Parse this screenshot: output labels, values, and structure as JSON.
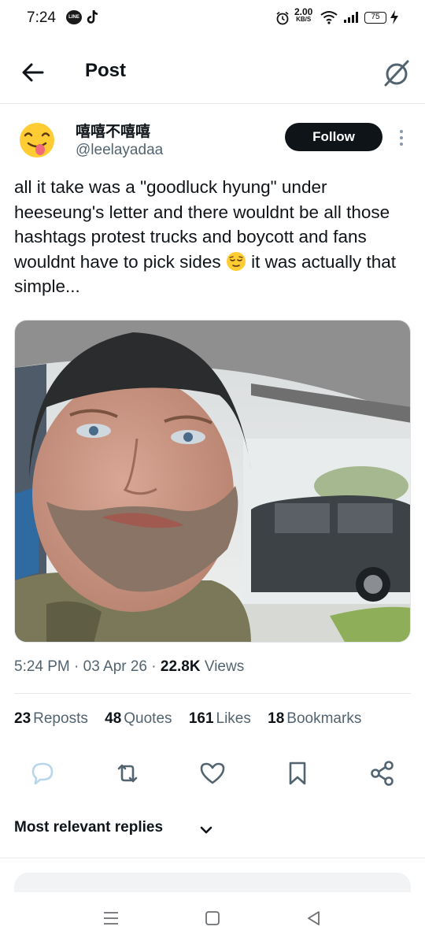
{
  "status_bar": {
    "time": "7:24",
    "app_icon_1": "LINE",
    "net_speed_value": "2.00",
    "net_speed_unit": "KB/S",
    "battery": "75"
  },
  "header": {
    "title": "Post",
    "back_icon": "arrow-left-icon",
    "grok_icon": "grok-icon"
  },
  "author": {
    "display_name": "嘻嘻不嘻嘻",
    "handle": "@leelayadaa",
    "follow_label": "Follow"
  },
  "tweet": {
    "text_part1": "all it take was a \"goodluck hyung\" under heeseung's letter and there wouldnt be all those hashtags protest trucks and boycott and fans wouldnt have to pick sides",
    "text_part2": " it was actually that simple...",
    "emoji": "relieved-face-emoji"
  },
  "meta": {
    "time": "5:24 PM",
    "sep1": " · ",
    "date": "03 Apr 26",
    "sep2": " · ",
    "views_count": "22.8K",
    "views_label": " Views"
  },
  "stats": [
    {
      "count": "23",
      "label": "Reposts"
    },
    {
      "count": "48",
      "label": "Quotes"
    },
    {
      "count": "161",
      "label": "Likes"
    },
    {
      "count": "18",
      "label": "Bookmarks"
    }
  ],
  "actions": [
    "reply-icon",
    "repost-icon",
    "like-icon",
    "bookmark-icon",
    "share-icon"
  ],
  "replies": {
    "sort_label": "Most relevant replies"
  },
  "colors": {
    "text_primary": "#0f1419",
    "text_secondary": "#536471",
    "divider": "#e6e8ea",
    "follow_bg": "#0f1419",
    "reply_icon": "#b8d6ea",
    "action_icon": "#536471"
  }
}
